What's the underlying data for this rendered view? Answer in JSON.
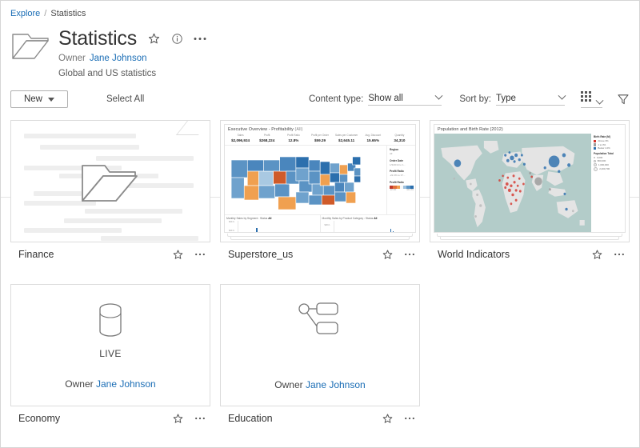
{
  "breadcrumb": {
    "root": "Explore",
    "separator": "/",
    "current": "Statistics"
  },
  "header": {
    "title": "Statistics",
    "owner_label": "Owner",
    "owner_name": "Jane Johnson",
    "description": "Global and US statistics",
    "icons": [
      "star-icon",
      "info-icon",
      "more-icon"
    ]
  },
  "toolbar": {
    "new_label": "New",
    "select_all_label": "Select All",
    "content_type_label": "Content type:",
    "content_type_value": "Show all",
    "sort_by_label": "Sort by:",
    "sort_by_value": "Type",
    "grid_view_icon": "grid-view-icon",
    "filter_icon": "filter-icon"
  },
  "cards": [
    {
      "name": "Finance",
      "type": "folder",
      "star_icon": "star-icon",
      "more_icon": "more-icon"
    },
    {
      "name": "Superstore_us",
      "type": "dashboard",
      "star_icon": "star-icon",
      "more_icon": "more-icon",
      "viz": {
        "title": "Executive Overview - Profitability",
        "title_suffix": "(All)",
        "kpis": [
          {
            "label": "Sales",
            "value": "$2,096,924"
          },
          {
            "label": "Profit",
            "value": "$268,224"
          },
          {
            "label": "Profit Ratio",
            "value": "12.8%"
          },
          {
            "label": "Profit per Order",
            "value": "$59.29"
          },
          {
            "label": "Sales per Customer",
            "value": "$2,645.11"
          },
          {
            "label": "Avg. Discount",
            "value": "15.65%"
          },
          {
            "label": "Quantity",
            "value": "34,310"
          }
        ],
        "filters": [
          {
            "head": "Region",
            "value": "All"
          },
          {
            "head": "Order Date",
            "value": "1/3/2014 to 1..."
          },
          {
            "head": "Profit Ratio",
            "value": "-22.3% to 37..."
          }
        ],
        "legend_head": "Profit Ratio",
        "legend_min": "-22.3%",
        "legend_max": "101.0%",
        "charts": [
          {
            "title": "Monthly Sales by Segment : Status",
            "status": "All",
            "axis_top": "$40.0..",
            "axis_bottom": "$40.0.."
          },
          {
            "title": "Monthly Sales by Product Category : Status",
            "status": "All",
            "axis_top": "$30.0..",
            "axis_bottom": ""
          }
        ]
      }
    },
    {
      "name": "World Indicators",
      "type": "dashboard",
      "star_icon": "star-icon",
      "more_icon": "more-icon",
      "viz": {
        "title": "Population and Birth Rate (2012)",
        "legend_birth_head": "Birth Rate (M)",
        "legend_birth_items": [
          {
            "label": "Above 3%",
            "color": "#d4332b"
          },
          {
            "label": "1 to 3%",
            "color": "#9e9e9e"
          },
          {
            "label": "Below 1.0%",
            "color": "#2c6fad"
          }
        ],
        "legend_pop_head": "Population Total",
        "legend_pop_items": [
          "0,000",
          "800,000",
          "1,600,000",
          "2,400,700"
        ]
      }
    },
    {
      "name": "Economy",
      "type": "datasource",
      "star_icon": "star-icon",
      "more_icon": "more-icon",
      "icon": "database-cylinder-icon",
      "live_label": "LIVE",
      "owner_label": "Owner",
      "owner_name": "Jane Johnson"
    },
    {
      "name": "Education",
      "type": "datasource",
      "star_icon": "star-icon",
      "more_icon": "more-icon",
      "icon": "data-relationship-icon",
      "live_label": "",
      "owner_label": "Owner",
      "owner_name": "Jane Johnson"
    }
  ],
  "colors": {
    "link": "#1a6db5",
    "text": "#333333",
    "border": "#dcdcdc",
    "map_ocean": "#b3ccc9",
    "viz_blue": "#2c6fad",
    "viz_orange": "#f0a050"
  }
}
